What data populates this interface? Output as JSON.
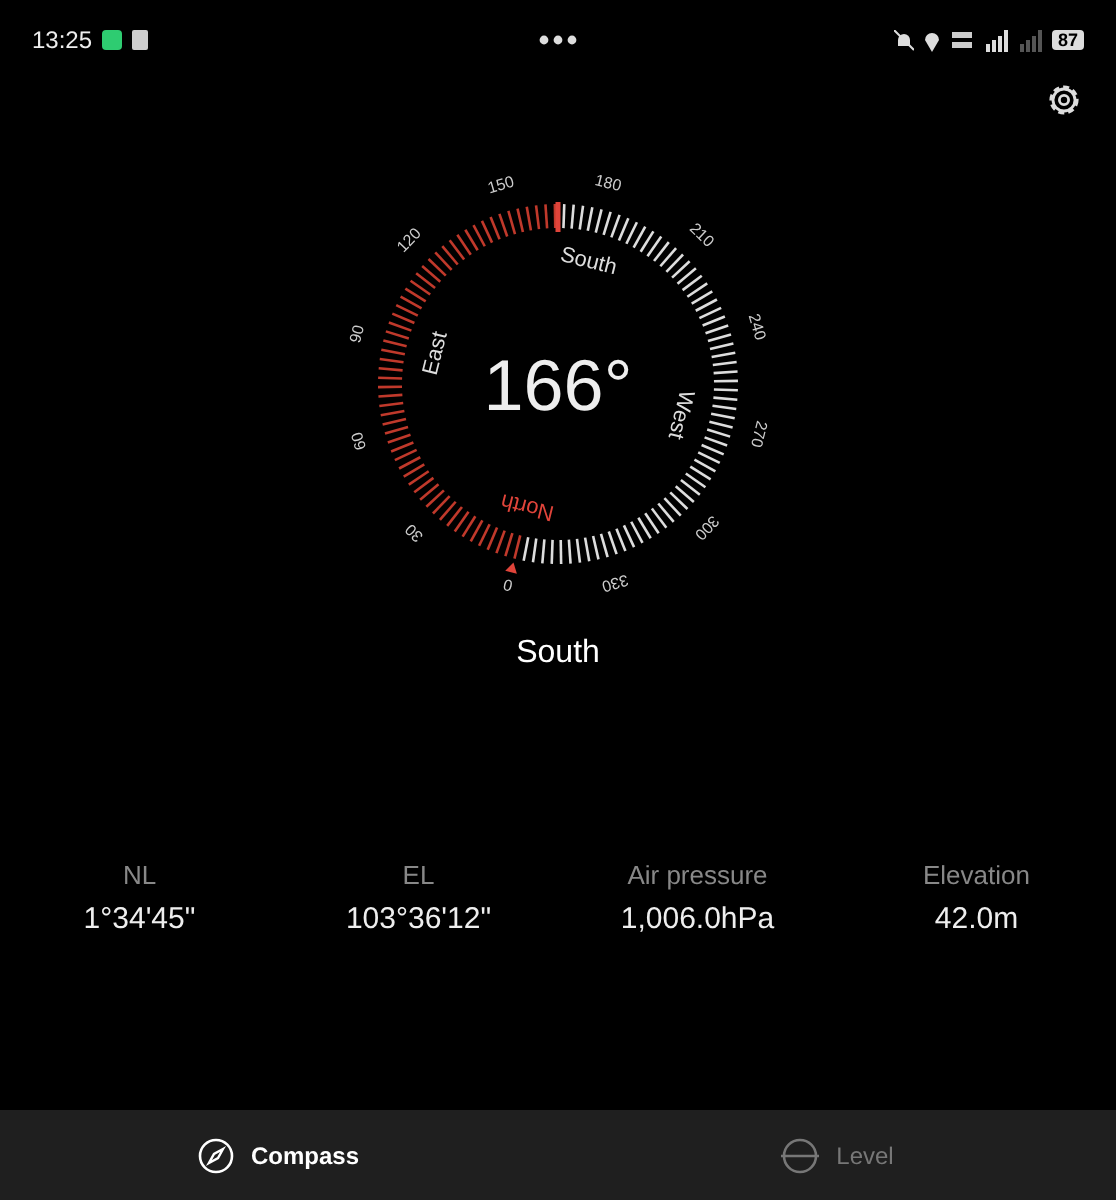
{
  "status_bar": {
    "time": "13:25",
    "battery": "87"
  },
  "dial": {
    "degree_labels": [
      "0",
      "30",
      "60",
      "90",
      "120",
      "150",
      "180",
      "210",
      "240",
      "270",
      "300",
      "330"
    ],
    "cardinals": [
      "North",
      "East",
      "South",
      "West"
    ],
    "heading": "166°"
  },
  "direction": "South",
  "stats": [
    {
      "label": "NL",
      "value": "1°34'45\""
    },
    {
      "label": "EL",
      "value": "103°36'12\""
    },
    {
      "label": "Air pressure",
      "value": "1,006.0hPa"
    },
    {
      "label": "Elevation",
      "value": "42.0m"
    }
  ],
  "tabs": [
    {
      "label": "Compass",
      "kind": "compass",
      "selected": true
    },
    {
      "label": "Level",
      "kind": "level",
      "selected": false
    }
  ]
}
